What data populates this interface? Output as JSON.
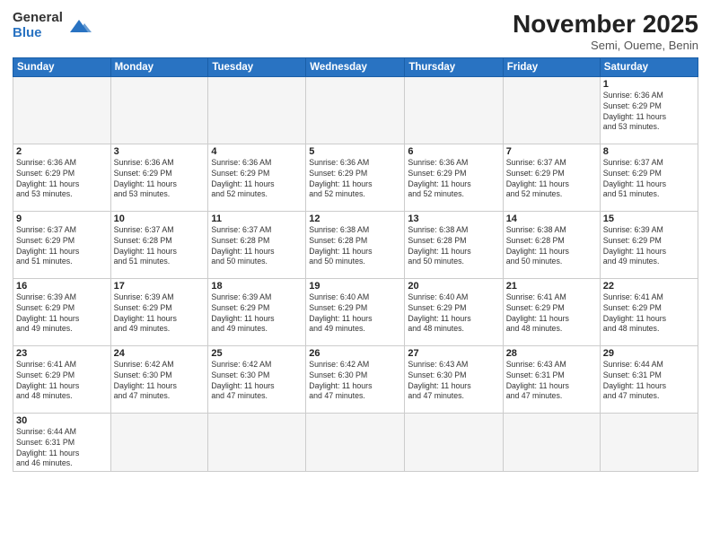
{
  "header": {
    "logo_general": "General",
    "logo_blue": "Blue",
    "month_title": "November 2025",
    "location": "Semi, Oueme, Benin"
  },
  "days_of_week": [
    "Sunday",
    "Monday",
    "Tuesday",
    "Wednesday",
    "Thursday",
    "Friday",
    "Saturday"
  ],
  "weeks": [
    [
      {
        "num": "",
        "info": ""
      },
      {
        "num": "",
        "info": ""
      },
      {
        "num": "",
        "info": ""
      },
      {
        "num": "",
        "info": ""
      },
      {
        "num": "",
        "info": ""
      },
      {
        "num": "",
        "info": ""
      },
      {
        "num": "1",
        "info": "Sunrise: 6:36 AM\nSunset: 6:29 PM\nDaylight: 11 hours\nand 53 minutes."
      }
    ],
    [
      {
        "num": "2",
        "info": "Sunrise: 6:36 AM\nSunset: 6:29 PM\nDaylight: 11 hours\nand 53 minutes."
      },
      {
        "num": "3",
        "info": "Sunrise: 6:36 AM\nSunset: 6:29 PM\nDaylight: 11 hours\nand 53 minutes."
      },
      {
        "num": "4",
        "info": "Sunrise: 6:36 AM\nSunset: 6:29 PM\nDaylight: 11 hours\nand 52 minutes."
      },
      {
        "num": "5",
        "info": "Sunrise: 6:36 AM\nSunset: 6:29 PM\nDaylight: 11 hours\nand 52 minutes."
      },
      {
        "num": "6",
        "info": "Sunrise: 6:36 AM\nSunset: 6:29 PM\nDaylight: 11 hours\nand 52 minutes."
      },
      {
        "num": "7",
        "info": "Sunrise: 6:37 AM\nSunset: 6:29 PM\nDaylight: 11 hours\nand 52 minutes."
      },
      {
        "num": "8",
        "info": "Sunrise: 6:37 AM\nSunset: 6:29 PM\nDaylight: 11 hours\nand 51 minutes."
      }
    ],
    [
      {
        "num": "9",
        "info": "Sunrise: 6:37 AM\nSunset: 6:29 PM\nDaylight: 11 hours\nand 51 minutes."
      },
      {
        "num": "10",
        "info": "Sunrise: 6:37 AM\nSunset: 6:28 PM\nDaylight: 11 hours\nand 51 minutes."
      },
      {
        "num": "11",
        "info": "Sunrise: 6:37 AM\nSunset: 6:28 PM\nDaylight: 11 hours\nand 50 minutes."
      },
      {
        "num": "12",
        "info": "Sunrise: 6:38 AM\nSunset: 6:28 PM\nDaylight: 11 hours\nand 50 minutes."
      },
      {
        "num": "13",
        "info": "Sunrise: 6:38 AM\nSunset: 6:28 PM\nDaylight: 11 hours\nand 50 minutes."
      },
      {
        "num": "14",
        "info": "Sunrise: 6:38 AM\nSunset: 6:28 PM\nDaylight: 11 hours\nand 50 minutes."
      },
      {
        "num": "15",
        "info": "Sunrise: 6:39 AM\nSunset: 6:29 PM\nDaylight: 11 hours\nand 49 minutes."
      }
    ],
    [
      {
        "num": "16",
        "info": "Sunrise: 6:39 AM\nSunset: 6:29 PM\nDaylight: 11 hours\nand 49 minutes."
      },
      {
        "num": "17",
        "info": "Sunrise: 6:39 AM\nSunset: 6:29 PM\nDaylight: 11 hours\nand 49 minutes."
      },
      {
        "num": "18",
        "info": "Sunrise: 6:39 AM\nSunset: 6:29 PM\nDaylight: 11 hours\nand 49 minutes."
      },
      {
        "num": "19",
        "info": "Sunrise: 6:40 AM\nSunset: 6:29 PM\nDaylight: 11 hours\nand 49 minutes."
      },
      {
        "num": "20",
        "info": "Sunrise: 6:40 AM\nSunset: 6:29 PM\nDaylight: 11 hours\nand 48 minutes."
      },
      {
        "num": "21",
        "info": "Sunrise: 6:41 AM\nSunset: 6:29 PM\nDaylight: 11 hours\nand 48 minutes."
      },
      {
        "num": "22",
        "info": "Sunrise: 6:41 AM\nSunset: 6:29 PM\nDaylight: 11 hours\nand 48 minutes."
      }
    ],
    [
      {
        "num": "23",
        "info": "Sunrise: 6:41 AM\nSunset: 6:29 PM\nDaylight: 11 hours\nand 48 minutes."
      },
      {
        "num": "24",
        "info": "Sunrise: 6:42 AM\nSunset: 6:30 PM\nDaylight: 11 hours\nand 47 minutes."
      },
      {
        "num": "25",
        "info": "Sunrise: 6:42 AM\nSunset: 6:30 PM\nDaylight: 11 hours\nand 47 minutes."
      },
      {
        "num": "26",
        "info": "Sunrise: 6:42 AM\nSunset: 6:30 PM\nDaylight: 11 hours\nand 47 minutes."
      },
      {
        "num": "27",
        "info": "Sunrise: 6:43 AM\nSunset: 6:30 PM\nDaylight: 11 hours\nand 47 minutes."
      },
      {
        "num": "28",
        "info": "Sunrise: 6:43 AM\nSunset: 6:31 PM\nDaylight: 11 hours\nand 47 minutes."
      },
      {
        "num": "29",
        "info": "Sunrise: 6:44 AM\nSunset: 6:31 PM\nDaylight: 11 hours\nand 47 minutes."
      }
    ],
    [
      {
        "num": "30",
        "info": "Sunrise: 6:44 AM\nSunset: 6:31 PM\nDaylight: 11 hours\nand 46 minutes."
      },
      {
        "num": "",
        "info": ""
      },
      {
        "num": "",
        "info": ""
      },
      {
        "num": "",
        "info": ""
      },
      {
        "num": "",
        "info": ""
      },
      {
        "num": "",
        "info": ""
      },
      {
        "num": "",
        "info": ""
      }
    ]
  ]
}
